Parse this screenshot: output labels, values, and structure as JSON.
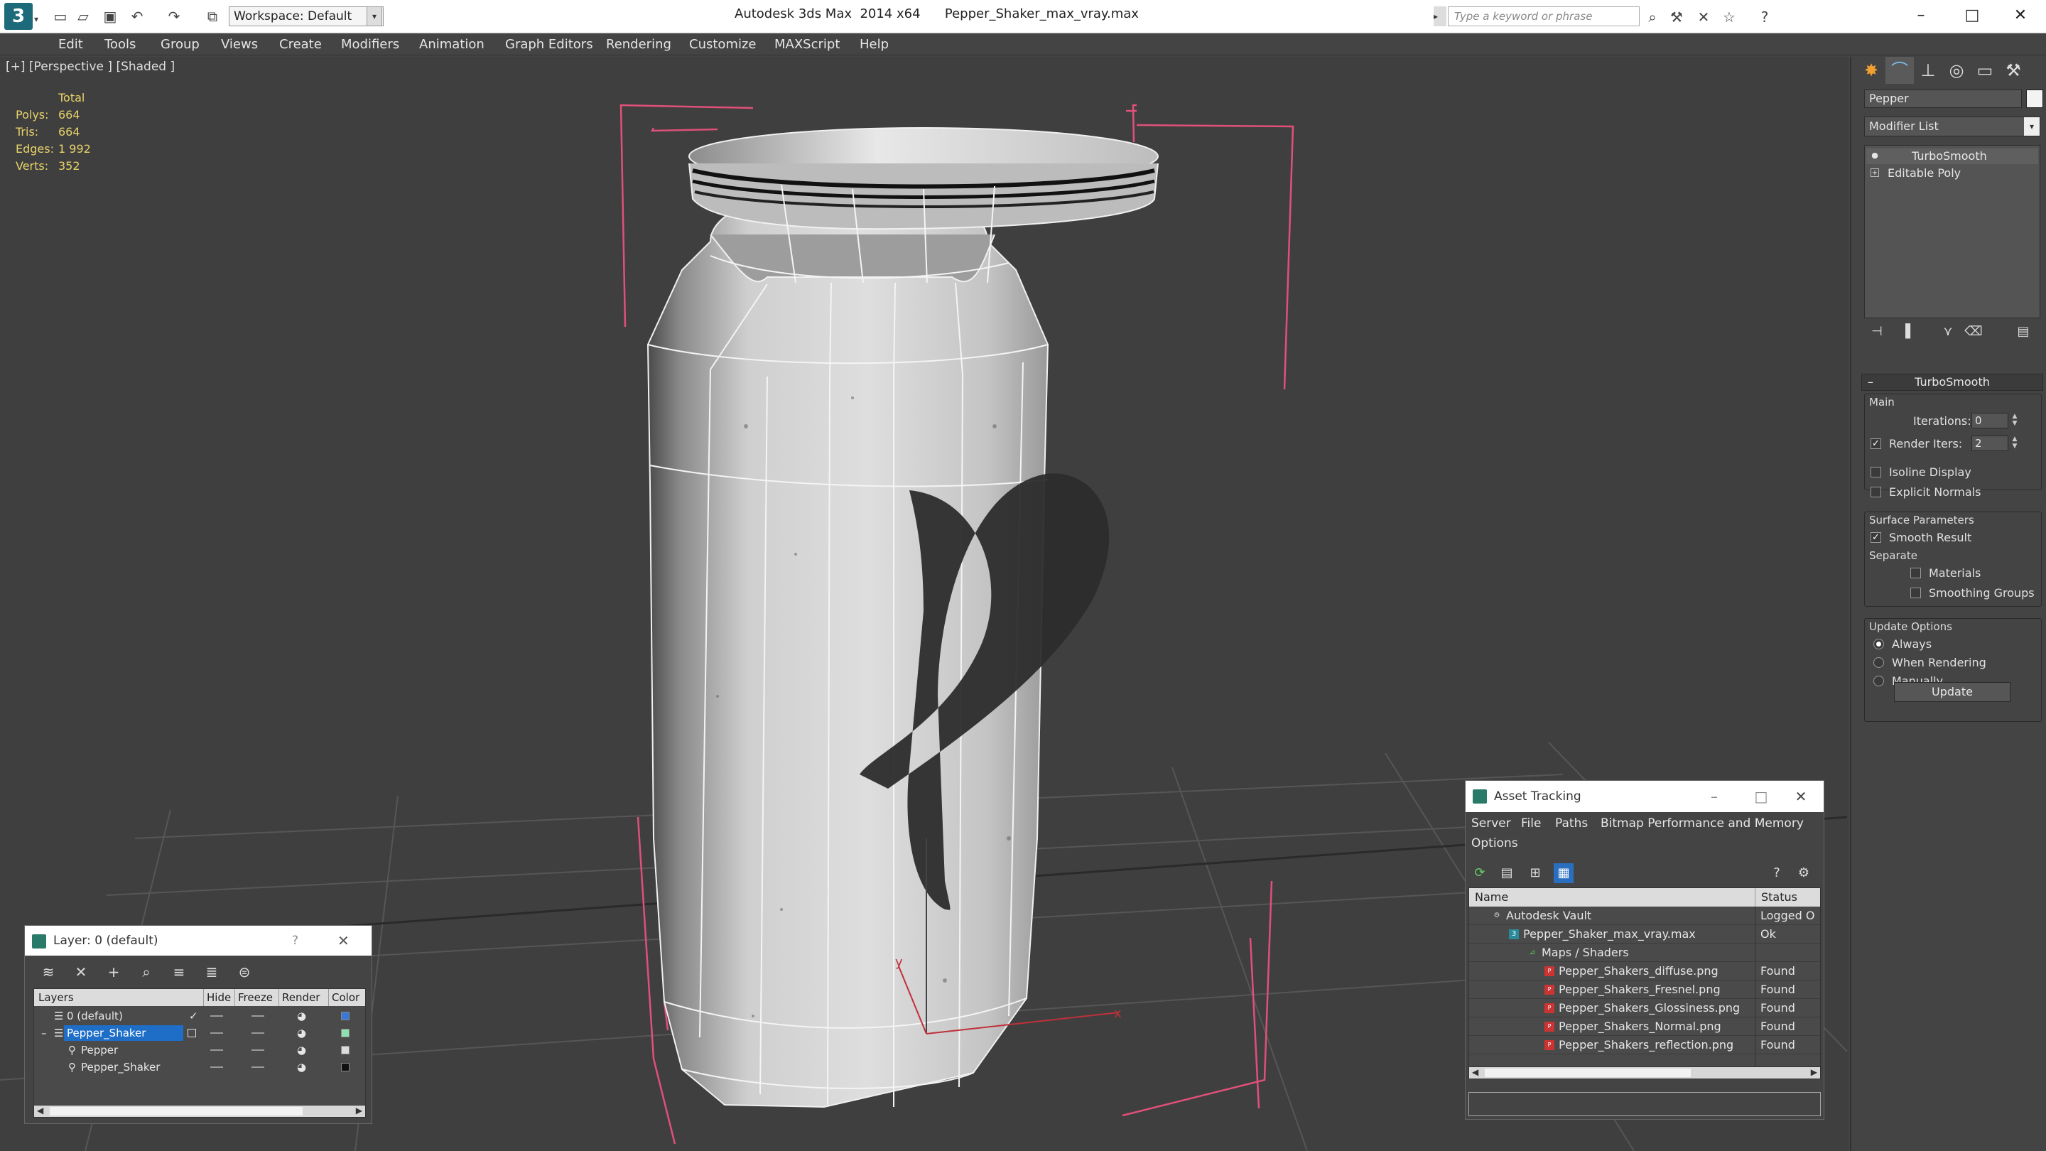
{
  "titlebar": {
    "workspace": "Workspace: Default",
    "app_title": "Autodesk 3ds Max  2014 x64",
    "file_name": "Pepper_Shaker_max_vray.max",
    "search_placeholder": "Type a keyword or phrase"
  },
  "menubar": {
    "items": [
      "Edit",
      "Tools",
      "Group",
      "Views",
      "Create",
      "Modifiers",
      "Animation",
      "Graph Editors",
      "Rendering",
      "Customize",
      "MAXScript",
      "Help"
    ]
  },
  "viewport": {
    "label": "[+] [Perspective ] [Shaded ]",
    "stats": {
      "header": "Total",
      "polys_label": "Polys:",
      "polys": "664",
      "tris_label": "Tris:",
      "tris": "664",
      "edges_label": "Edges:",
      "edges": "1 992",
      "verts_label": "Verts:",
      "verts": "352"
    },
    "gizmo": {
      "y_label": "y",
      "x_label": "x"
    },
    "label_mark": "P"
  },
  "command_panel": {
    "object_name": "Pepper",
    "object_color": "#f3f3f3",
    "modifier_list": "Modifier List",
    "stack": [
      "TurboSmooth",
      "Editable Poly"
    ],
    "rollout_title": "TurboSmooth",
    "main": {
      "title": "Main",
      "iterations_label": "Iterations:",
      "iterations": "0",
      "render_iters_label": "Render Iters:",
      "render_iters": "2",
      "isoline_label": "Isoline Display",
      "explicit_normals_label": "Explicit Normals"
    },
    "surface": {
      "title": "Surface Parameters",
      "smooth_result_label": "Smooth Result",
      "separate_label": "Separate",
      "materials_label": "Materials",
      "smoothing_groups_label": "Smoothing Groups"
    },
    "update_options": {
      "title": "Update Options",
      "always": "Always",
      "when_rendering": "When Rendering",
      "manually": "Manually",
      "update_button": "Update"
    }
  },
  "asset_tracking": {
    "title": "Asset Tracking",
    "menu": [
      "Server",
      "File",
      "Paths",
      "Bitmap Performance and Memory",
      "Options"
    ],
    "columns": {
      "name": "Name",
      "status": "Status"
    },
    "rows": [
      {
        "name": "Autodesk Vault",
        "status": "Logged O"
      },
      {
        "name": "Pepper_Shaker_max_vray.max",
        "status": "Ok"
      },
      {
        "name": "Maps / Shaders",
        "status": ""
      },
      {
        "name": "Pepper_Shakers_diffuse.png",
        "status": "Found"
      },
      {
        "name": "Pepper_Shakers_Fresnel.png",
        "status": "Found"
      },
      {
        "name": "Pepper_Shakers_Glossiness.png",
        "status": "Found"
      },
      {
        "name": "Pepper_Shakers_Normal.png",
        "status": "Found"
      },
      {
        "name": "Pepper_Shakers_reflection.png",
        "status": "Found"
      }
    ]
  },
  "layer_explorer": {
    "title": "Layer: 0 (default)",
    "help": "?",
    "columns": {
      "layers": "Layers",
      "hide": "Hide",
      "freeze": "Freeze",
      "render": "Render",
      "color": "Color"
    },
    "rows": [
      {
        "name": "0 (default)",
        "color": "#3a78d8"
      },
      {
        "name": "Pepper_Shaker",
        "color": "#8fe0b0"
      },
      {
        "name": "Pepper",
        "color": "#dcdcdc"
      },
      {
        "name": "Pepper_Shaker",
        "color": "#111111"
      }
    ]
  },
  "colors": {
    "accent": "#1e6ec8",
    "stats_yellow": "#e8d36a",
    "bbox_pink": "#e0507a"
  }
}
